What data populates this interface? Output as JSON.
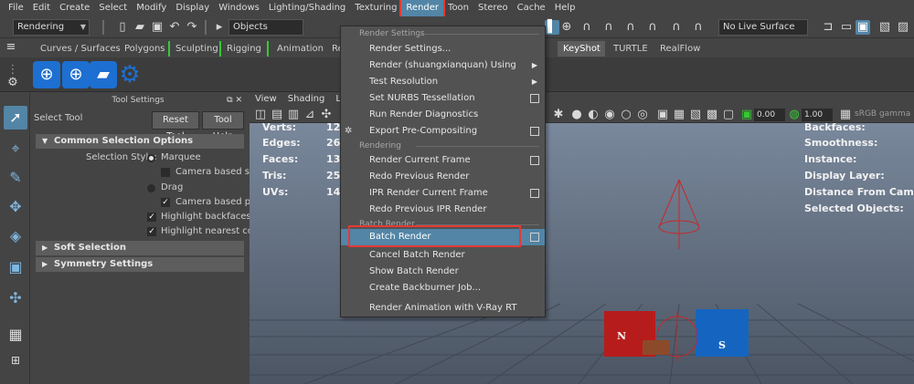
{
  "menubar": {
    "items": [
      "File",
      "Edit",
      "Create",
      "Select",
      "Modify",
      "Display",
      "Windows",
      "Lighting/Shading",
      "Texturing",
      "Render",
      "Toon",
      "Stereo",
      "Cache",
      "Help"
    ],
    "active_index": 9
  },
  "statusline": {
    "menuset": "Rendering",
    "selection_mask": "Objects",
    "live_surface": "No Live Surface"
  },
  "shelf": {
    "tabs": [
      "Curves / Surfaces",
      "Polygons",
      "Sculpting",
      "Rigging",
      "Animation",
      "Re",
      "KeyShot",
      "TURTLE",
      "RealFlow"
    ],
    "active_tab": "KeyShot"
  },
  "tool_settings": {
    "header": "Tool Settings",
    "tool_name": "Select Tool",
    "reset_button": "Reset Tool",
    "help_button": "Tool Help",
    "sections": {
      "common": "Common Selection Options",
      "soft": "Soft Selection",
      "symmetry": "Symmetry Settings"
    },
    "selection_style_label": "Selection Style:",
    "marquee": "Marquee",
    "camera_based_sel": "Camera based sel",
    "drag": "Drag",
    "camera_based_pai": "Camera based pai",
    "highlight_backfaces": "Highlight backfaces",
    "highlight_nearest": "Highlight nearest com"
  },
  "viewport": {
    "menu": [
      "View",
      "Shading",
      "Light"
    ],
    "field_a": "0.00",
    "field_b": "1.00",
    "color_space": "sRGB gamma",
    "hud_left": [
      "Verts:",
      "Edges:",
      "Faces:",
      "Tris:",
      "UVs:"
    ],
    "hud_left_values": [
      "12",
      "26",
      "13",
      "25",
      "14"
    ],
    "hud_right": [
      "Backfaces:",
      "Smoothness:",
      "Instance:",
      "Display Layer:",
      "Distance From Camer",
      "Selected Objects:"
    ],
    "magnet_n": "N",
    "magnet_s": "S"
  },
  "render_menu": {
    "section_settings": "Render Settings",
    "section_rendering": "Rendering",
    "section_batch": "Batch Render",
    "items": {
      "render_settings": "Render Settings...",
      "render_using": "Render (shuangxianquan) Using",
      "test_resolution": "Test Resolution",
      "set_nurbs": "Set NURBS Tessellation",
      "run_diagnostics": "Run Render Diagnostics",
      "export_precomp": "Export Pre-Compositing",
      "render_current": "Render Current Frame",
      "redo_previous": "Redo Previous Render",
      "ipr_current": "IPR Render Current Frame",
      "redo_ipr": "Redo Previous IPR Render",
      "batch_render": "Batch Render",
      "cancel_batch": "Cancel Batch Render",
      "show_batch": "Show Batch Render",
      "create_backburner": "Create Backburner Job...",
      "render_vray": "Render Animation with V-Ray RT"
    }
  },
  "colors": {
    "highlight": "#5285a6",
    "annotation_red": "#e53935",
    "ui_bg": "#444444"
  }
}
